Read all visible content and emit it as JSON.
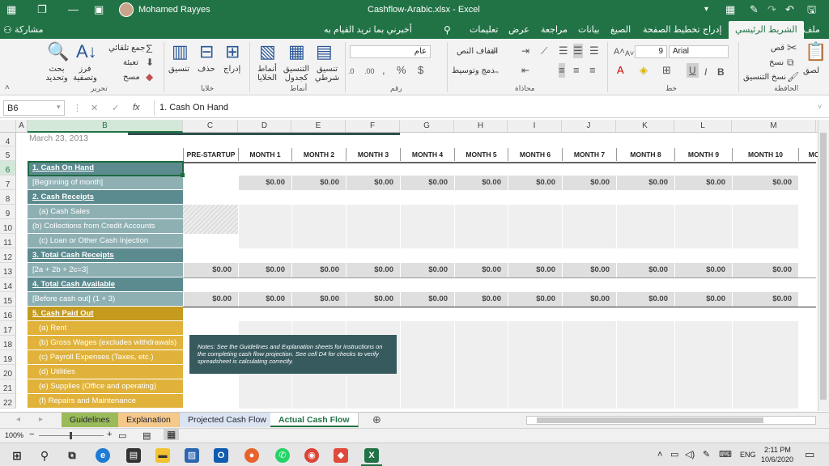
{
  "title_bar": {
    "user": "Mohamed Rayyes",
    "doc_title": "Cashflow-Arabic.xlsx  -  Excel"
  },
  "ribbon_tabs": [
    "ملف",
    "الشريط الرئيسي",
    "إدراج",
    "تخطيط الصفحة",
    "الصيغ",
    "بيانات",
    "مراجعة",
    "عرض",
    "تعليمات",
    "أخبرني بما تريد القيام به",
    "مشاركة"
  ],
  "ribbon": {
    "font_name": "Arial",
    "font_size": "9",
    "number_format": "عام",
    "paste": "لصق",
    "cut": "قص",
    "copy": "نسخ",
    "format_painter": "نسخ التنسيق",
    "clipboard_group": "الحافظة",
    "font_group": "خط",
    "wrap_text": "التفاف النص",
    "merge_center": "دمج وتوسيط",
    "alignment_group": "محاذاة",
    "number_group": "رقم",
    "cond_format": "تنسيق شرطي",
    "format_table": "التنسيق كجدول",
    "cell_styles": "أنماط الخلايا",
    "styles_group": "أنماط",
    "insert": "إدراج",
    "delete": "حذف",
    "format": "تنسيق",
    "cells_group": "خلايا",
    "autosum": "جمع تلقائي",
    "fill": "تعبئة",
    "clear": "مسح",
    "sort_filter": "فرز وتصفية",
    "find_select": "بحث وتحديد",
    "editing_group": "تحرير"
  },
  "formula_bar": {
    "name_box": "B6",
    "content": "1. Cash On Hand"
  },
  "columns": [
    "A",
    "B",
    "C",
    "D",
    "E",
    "F",
    "G",
    "H",
    "I",
    "J",
    "K",
    "L",
    "M"
  ],
  "rows": [
    "4",
    "5",
    "6",
    "7",
    "8",
    "9",
    "10",
    "11",
    "12",
    "13",
    "14",
    "15",
    "16",
    "17",
    "18",
    "19",
    "20",
    "21",
    "22"
  ],
  "date": "March 23, 2013",
  "month_headers": [
    "PRE-STARTUP",
    "MONTH 1",
    "MONTH 2",
    "MONTH 3",
    "MONTH 4",
    "MONTH 5",
    "MONTH 6",
    "MONTH 7",
    "MONTH 8",
    "MONTH 9",
    "MONTH 10",
    "MO"
  ],
  "labels": [
    "1. Cash On Hand",
    "[Beginning of month]",
    "2. Cash Receipts",
    "(a) Cash Sales",
    "(b) Collections from Credit Accounts",
    "(c) Loan or Other Cash Injection",
    "3. Total Cash Receipts",
    "[2a + 2b + 2c=3]",
    "4. Total Cash Available",
    "[Before cash out] (1 + 3)",
    "5. Cash Paid Out",
    "(a) Rent",
    "(b) Gross Wages (excludes withdrawals)",
    "(c) Payroll Expenses (Taxes, etc.)",
    "(d) Utilities",
    "(e) Supplies (Office and operating)",
    "(f) Repairs and Maintenance"
  ],
  "money": "$0.00",
  "note": "Notes: See the Guidelines and Explanation sheets for instructions on the completing cash flow projection. See cell  D4 for checks to verify spreadsheet is calculating correctly.",
  "sheet_tabs": [
    "Guidelines",
    "Explanation",
    "Projected Cash Flow",
    "Actual Cash Flow"
  ],
  "status": {
    "zoom": "100%"
  },
  "taskbar": {
    "time": "2:11 PM",
    "date": "10/6/2020",
    "lang": "ENG"
  }
}
